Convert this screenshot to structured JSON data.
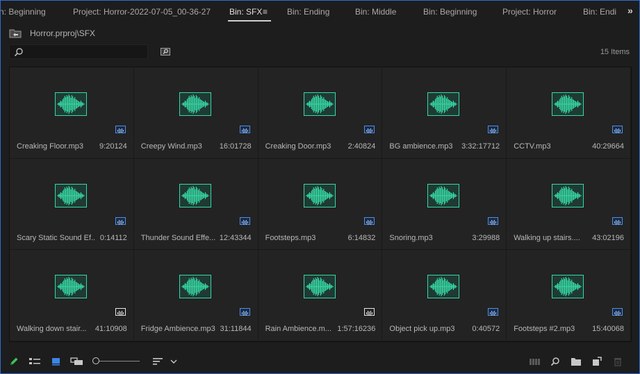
{
  "tabs": [
    {
      "label": "n: Beginning",
      "active": false
    },
    {
      "label": "Project: Horror-2022-07-05_00-36-27",
      "active": false
    },
    {
      "label": "Bin: SFX",
      "active": true
    },
    {
      "label": "Bin: Ending",
      "active": false
    },
    {
      "label": "Bin: Middle",
      "active": false
    },
    {
      "label": "Bin: Beginning",
      "active": false
    },
    {
      "label": "Project: Horror",
      "active": false
    },
    {
      "label": "Bin: Endi",
      "active": false
    }
  ],
  "tab_menu_icon": "hamburger-icon",
  "overflow_icon": "double-chevron-right-icon",
  "path": "Horror.prproj\\SFX",
  "search": {
    "value": "",
    "placeholder": ""
  },
  "items_count": "15 Items",
  "colors": {
    "accent": "#2d6fd6",
    "waveform": "#37d9a4",
    "badge_blue": "#4f8fe6"
  },
  "items": [
    {
      "name": "Creaking Floor.mp3",
      "duration": "9:20124",
      "badge": "blue"
    },
    {
      "name": "Creepy Wind.mp3",
      "duration": "16:01728",
      "badge": "blue"
    },
    {
      "name": "Creaking Door.mp3",
      "duration": "2:40824",
      "badge": "blue"
    },
    {
      "name": "BG ambience.mp3",
      "duration": "3:32:17712",
      "badge": "blue"
    },
    {
      "name": "CCTV.mp3",
      "duration": "40:29664",
      "badge": "blue"
    },
    {
      "name": "Scary Static Sound Ef...",
      "duration": "0:14112",
      "badge": "blue"
    },
    {
      "name": "Thunder Sound Effe...",
      "duration": "12:43344",
      "badge": "blue"
    },
    {
      "name": "Footsteps.mp3",
      "duration": "6:14832",
      "badge": "blue"
    },
    {
      "name": "Snoring.mp3",
      "duration": "3:29988",
      "badge": "blue"
    },
    {
      "name": "Walking up stairs....",
      "duration": "43:02196",
      "badge": "blue"
    },
    {
      "name": "Walking down stair...",
      "duration": "41:10908",
      "badge": "white"
    },
    {
      "name": "Fridge Ambience.mp3",
      "duration": "31:11844",
      "badge": "blue"
    },
    {
      "name": "Rain Ambience.m...",
      "duration": "1:57:16236",
      "badge": "white"
    },
    {
      "name": "Object pick up.mp3",
      "duration": "0:40572",
      "badge": "blue"
    },
    {
      "name": "Footsteps #2.mp3",
      "duration": "15:40068",
      "badge": "blue"
    }
  ],
  "toolbar": {
    "icons": [
      "pencil-icon",
      "list-view-icon",
      "icon-view-icon",
      "freeform-view-icon",
      "zoom-slider",
      "sort-icon",
      "chevron-down-icon",
      "automate-sequence-icon",
      "find-icon",
      "new-bin-icon",
      "new-item-icon",
      "trash-icon"
    ],
    "zoom_level": 0
  }
}
